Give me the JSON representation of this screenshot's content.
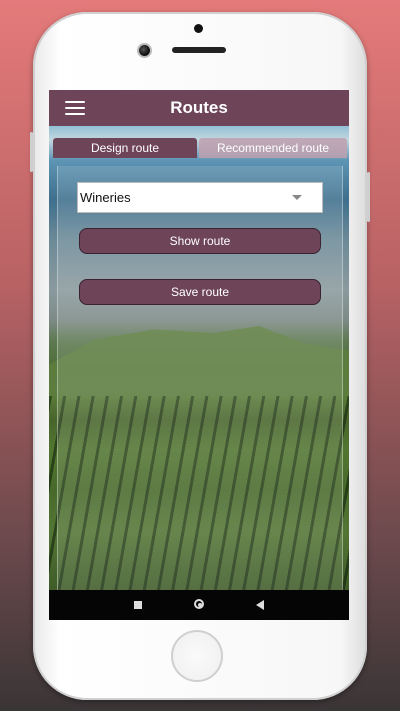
{
  "appbar": {
    "title": "Routes",
    "menu_icon": "hamburger-menu-icon",
    "color": "#6e4459"
  },
  "tabs": [
    {
      "label": "Design route",
      "active": true
    },
    {
      "label": "Recommended route",
      "active": false
    }
  ],
  "route_select": {
    "value": "Wineries",
    "icon": "dropdown-caret-icon"
  },
  "buttons": {
    "show_label": "Show route",
    "save_label": "Save route"
  },
  "navbar": {
    "recents_icon": "square-icon",
    "home_icon": "circle-icon",
    "back_icon": "triangle-back-icon"
  }
}
